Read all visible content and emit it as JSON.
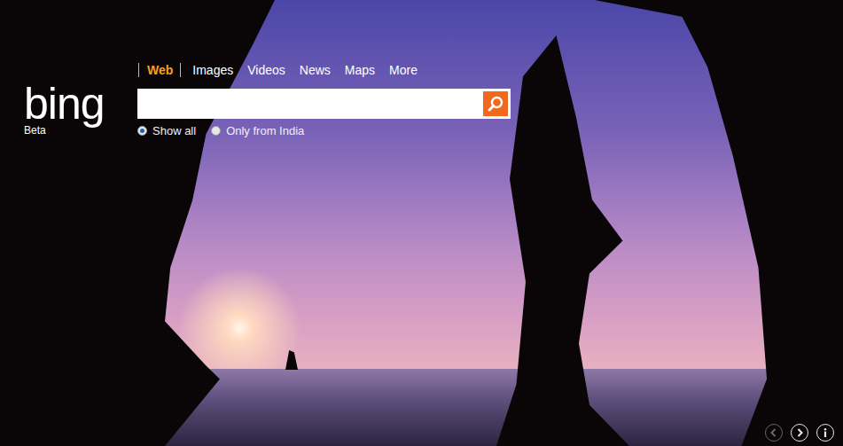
{
  "logo": {
    "text": "bing",
    "badge": "Beta"
  },
  "nav": [
    {
      "label": "Web",
      "selected": true
    },
    {
      "label": "Images",
      "selected": false
    },
    {
      "label": "Videos",
      "selected": false
    },
    {
      "label": "News",
      "selected": false
    },
    {
      "label": "Maps",
      "selected": false
    },
    {
      "label": "More",
      "selected": false
    }
  ],
  "search": {
    "value": ""
  },
  "scope": [
    {
      "label": "Show all",
      "selected": true
    },
    {
      "label": "Only from India",
      "selected": false
    }
  ],
  "slide_controls": [
    {
      "kind": "prev",
      "disabled": true
    },
    {
      "kind": "next",
      "disabled": false
    },
    {
      "kind": "info",
      "disabled": false
    }
  ]
}
